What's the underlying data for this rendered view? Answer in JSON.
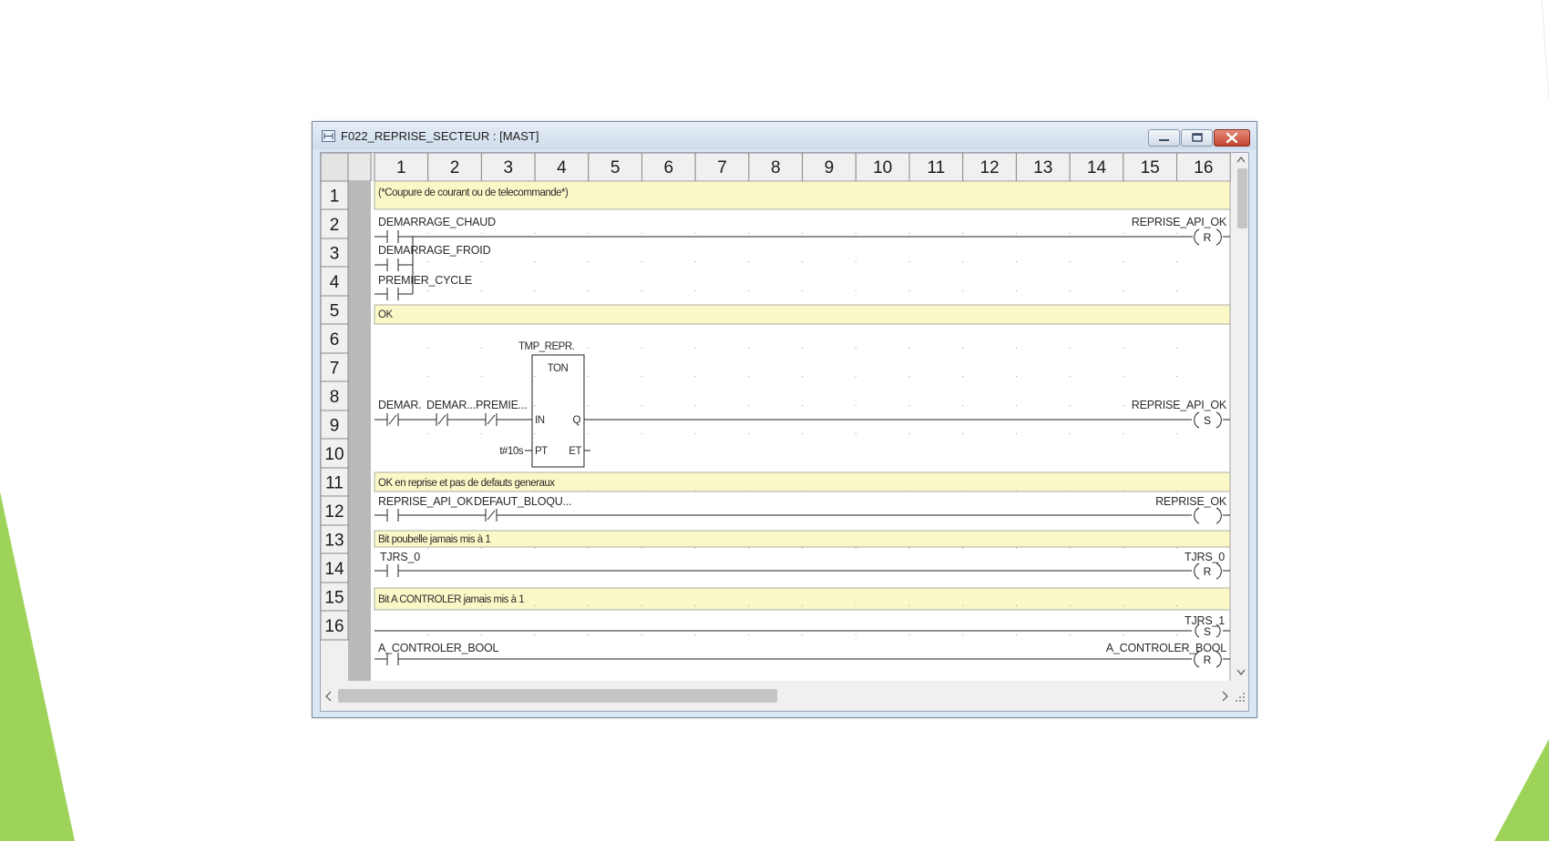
{
  "window": {
    "title": "F022_REPRISE_SECTEUR : [MAST]"
  },
  "columns": [
    "1",
    "2",
    "3",
    "4",
    "5",
    "6",
    "7",
    "8",
    "9",
    "10",
    "11",
    "12",
    "13",
    "14",
    "15",
    "16"
  ],
  "rows": [
    "1",
    "2",
    "3",
    "4",
    "5",
    "6",
    "7",
    "8",
    "9",
    "10",
    "11",
    "12",
    "13",
    "14",
    "15",
    "16"
  ],
  "comments": {
    "r1": "(*Coupure de courant ou de telecommande*)",
    "r5": "OK",
    "r10": "OK en reprise et pas de defauts generaux",
    "r12": "Bit poubelle jamais mis à 1",
    "r14": "Bit A CONTROLER jamais mis à 1"
  },
  "contacts": {
    "demarrage_chaud": "DEMARRAGE_CHAUD",
    "demarrage_froid": "DEMARRAGE_FROID",
    "premier_cycle": "PREMIER_CYCLE",
    "demar_short_1": "DEMAR.",
    "demar_short_2": "DEMAR...",
    "premie_short": "PREMIE...",
    "reprise_api_ok": "REPRISE_API_OK",
    "defaut_bloqu": "DEFAUT_BLOQU...",
    "tjrs_0": "TJRS_0",
    "a_controler_bool": "A_CONTROLER_BOOL"
  },
  "timer": {
    "instance": "TMP_REPR.",
    "type": "TON",
    "in": "IN",
    "q": "Q",
    "pt": "PT",
    "et": "ET",
    "preset": "t#10s"
  },
  "coils": {
    "reprise_api_ok_r": {
      "name": "REPRISE_API_OK",
      "type": "R"
    },
    "reprise_api_ok_s": {
      "name": "REPRISE_API_OK",
      "type": "S"
    },
    "reprise_ok": {
      "name": "REPRISE_OK",
      "type": ""
    },
    "tjrs_0": {
      "name": "TJRS_0",
      "type": "R"
    },
    "tjrs_1": {
      "name": "TJRS_1",
      "type": "S"
    },
    "a_controler_bool": {
      "name": "A_CONTROLER_BOOL",
      "type": "R"
    }
  },
  "scrollbars": {
    "up_arrow": "^",
    "down_arrow": "v",
    "left_arrow": "<",
    "right_arrow": ">"
  },
  "colors": {
    "comment_bg": "#fbf8c8",
    "gutter": "#b9b9b9",
    "header_bg": "#f0f0f0",
    "deco_green": "#9ed35a"
  }
}
